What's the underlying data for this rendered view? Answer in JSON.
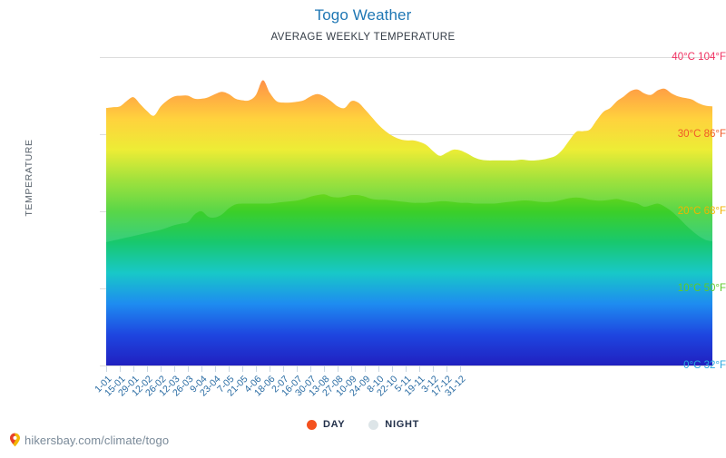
{
  "header": {
    "title": "Togo Weather",
    "subtitle": "AVERAGE WEEKLY TEMPERATURE"
  },
  "footer": {
    "url": "hikersbay.com/climate/togo",
    "pin_icon": "map-pin-icon"
  },
  "legend": {
    "position": "bottom-center",
    "items": [
      {
        "label": "DAY",
        "color": "#F4511E",
        "icon": "day-marker-icon"
      },
      {
        "label": "NIGHT",
        "color": "#DDE5E8",
        "icon": "night-marker-icon"
      }
    ]
  },
  "colors": {
    "title": "#1F77B4",
    "subtitle": "#333b45",
    "axis_label": "#5a646e",
    "xtick": "#2a6ca3",
    "grid": "#dcdcdc",
    "day": "#F4511E",
    "night": "#DDE5E8",
    "footer": "#7a8a99",
    "gradient_stops": [
      "#2020C0",
      "#1E46E0",
      "#1E8CF0",
      "#18C8C8",
      "#18C86E",
      "#3CCF28",
      "#8ADB12",
      "#E8E800",
      "#FFC400",
      "#FF7A00",
      "#FF2A00"
    ]
  },
  "chart_data": {
    "type": "area",
    "title": "Togo Weather",
    "subtitle": "AVERAGE WEEKLY TEMPERATURE",
    "xlabel": "",
    "ylabel": "TEMPERATURE",
    "ylim": [
      0,
      40
    ],
    "grid": true,
    "yticks": [
      {
        "value": 40,
        "label": "40°C 104°F",
        "color": "#F03060"
      },
      {
        "value": 30,
        "label": "30°C 86°F",
        "color": "#F05A28"
      },
      {
        "value": 20,
        "label": "20°C 68°F",
        "color": "#F0B400"
      },
      {
        "value": 10,
        "label": "10°C 50°F",
        "color": "#5ECA2A"
      },
      {
        "value": 0,
        "label": "0°C 32°F",
        "color": "#2AA8E0"
      }
    ],
    "categories": [
      "1-01",
      "15-01",
      "29-01",
      "12-02",
      "26-02",
      "12-03",
      "26-03",
      "9-04",
      "23-04",
      "7-05",
      "21-05",
      "4-06",
      "18-06",
      "2-07",
      "16-07",
      "30-07",
      "13-08",
      "27-08",
      "10-09",
      "24-09",
      "8-10",
      "22-10",
      "5-11",
      "19-11",
      "3-12",
      "17-12",
      "31-12"
    ],
    "x_tick_step_weeks": 2,
    "series": [
      {
        "name": "DAY",
        "color": "#F4511E",
        "values": [
          33.4,
          33.5,
          33.6,
          34.3,
          34.8,
          33.9,
          33.0,
          32.4,
          33.6,
          34.4,
          34.9,
          35.0,
          35.0,
          34.6,
          34.6,
          34.8,
          35.2,
          35.5,
          35.2,
          34.6,
          34.4,
          34.4,
          35.1,
          37.0,
          35.4,
          34.3,
          34.1,
          34.1,
          34.2,
          34.4,
          34.9,
          35.2,
          34.9,
          34.3,
          33.6,
          33.4,
          34.3,
          34.1,
          33.2,
          32.2,
          31.2,
          30.4,
          29.8,
          29.4,
          29.2,
          29.2,
          29.0,
          28.6,
          27.8,
          27.2,
          27.6,
          28.0,
          27.9,
          27.5,
          27.0,
          26.7,
          26.6,
          26.6,
          26.6,
          26.6,
          26.6,
          26.7,
          26.6,
          26.6,
          26.7,
          26.9,
          27.2,
          28.0,
          29.2,
          30.3,
          30.4,
          30.6,
          31.8,
          32.9,
          33.4,
          34.3,
          34.9,
          35.6,
          35.8,
          35.3,
          35.1,
          35.7,
          35.9,
          35.3,
          34.9,
          34.7,
          34.5,
          34.0,
          33.7,
          33.6
        ]
      },
      {
        "name": "NIGHT",
        "color": "#DDE5E8",
        "values": [
          16.0,
          16.2,
          16.4,
          16.6,
          16.8,
          17.0,
          17.2,
          17.4,
          17.6,
          17.9,
          18.2,
          18.4,
          18.6,
          19.6,
          20.0,
          19.3,
          19.2,
          19.6,
          20.4,
          20.9,
          21.0,
          21.0,
          21.0,
          21.0,
          21.0,
          21.1,
          21.2,
          21.3,
          21.4,
          21.6,
          21.9,
          22.1,
          22.2,
          21.9,
          21.8,
          21.9,
          22.1,
          22.1,
          21.9,
          21.6,
          21.5,
          21.5,
          21.4,
          21.3,
          21.2,
          21.1,
          21.1,
          21.1,
          21.2,
          21.3,
          21.3,
          21.2,
          21.1,
          21.1,
          21.0,
          21.0,
          21.0,
          21.0,
          21.1,
          21.2,
          21.3,
          21.4,
          21.4,
          21.3,
          21.2,
          21.2,
          21.3,
          21.5,
          21.7,
          21.8,
          21.7,
          21.5,
          21.4,
          21.4,
          21.5,
          21.6,
          21.4,
          21.2,
          21.0,
          20.6,
          20.8,
          21.0,
          20.6,
          20.0,
          19.2,
          18.3,
          17.5,
          16.8,
          16.3,
          16.1
        ]
      }
    ]
  }
}
